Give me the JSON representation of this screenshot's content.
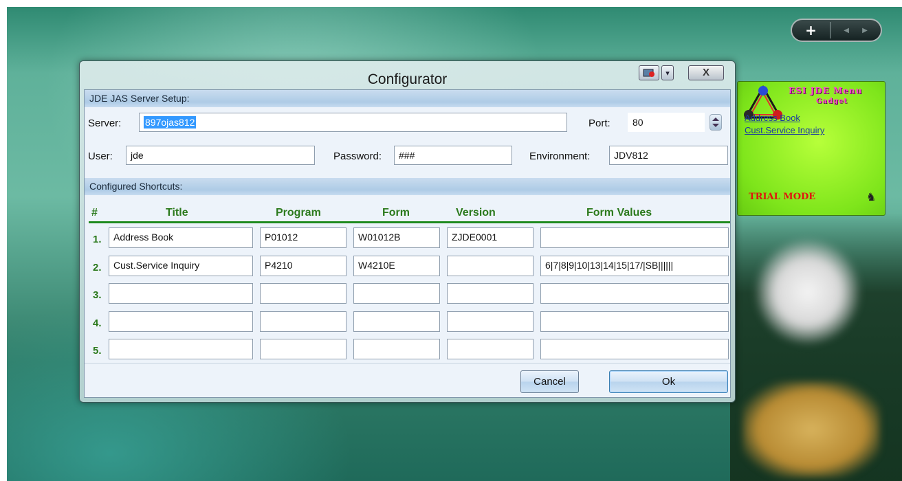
{
  "window": {
    "title": "Configurator",
    "close_label": "X"
  },
  "server_setup": {
    "section_title": "JDE JAS Server Setup:",
    "server_label": "Server:",
    "server_value": "897ojas812",
    "port_label": "Port:",
    "port_value": "80",
    "user_label": "User:",
    "user_value": "jde",
    "password_label": "Password:",
    "password_value": "###",
    "environment_label": "Environment:",
    "environment_value": "JDV812"
  },
  "shortcuts": {
    "section_title": "Configured Shortcuts:",
    "columns": {
      "num": "#",
      "title": "Title",
      "program": "Program",
      "form": "Form",
      "version": "Version",
      "form_values": "Form Values"
    },
    "rows": [
      {
        "num": "1.",
        "title": "Address Book",
        "program": "P01012",
        "form": "W01012B",
        "version": "ZJDE0001",
        "form_values": ""
      },
      {
        "num": "2.",
        "title": "Cust.Service Inquiry",
        "program": "P4210",
        "form": "W4210E",
        "version": "",
        "form_values": "6|7|8|9|10|13|14|15|17/|SB||||||"
      },
      {
        "num": "3.",
        "title": "",
        "program": "",
        "form": "",
        "version": "",
        "form_values": ""
      },
      {
        "num": "4.",
        "title": "",
        "program": "",
        "form": "",
        "version": "",
        "form_values": ""
      },
      {
        "num": "5.",
        "title": "",
        "program": "",
        "form": "",
        "version": "",
        "form_values": ""
      }
    ]
  },
  "buttons": {
    "cancel": "Cancel",
    "ok": "Ok"
  },
  "gadget": {
    "title_line1": "ESI JDE Menu",
    "title_line2": "Gadget",
    "links": [
      "Address Book",
      "Cust.Service Inquiry"
    ],
    "trial": "TRIAL MODE"
  },
  "sidebar": {
    "add_label": "+",
    "prev_icon": "◀",
    "next_icon": "▶"
  },
  "colors": {
    "accent_green": "#2c7a1d",
    "selection_blue": "#3399ff",
    "gadget_bg": "#7ee51b",
    "trial_red": "#e0150e",
    "gadget_title_magenta": "#ff3fd4"
  }
}
